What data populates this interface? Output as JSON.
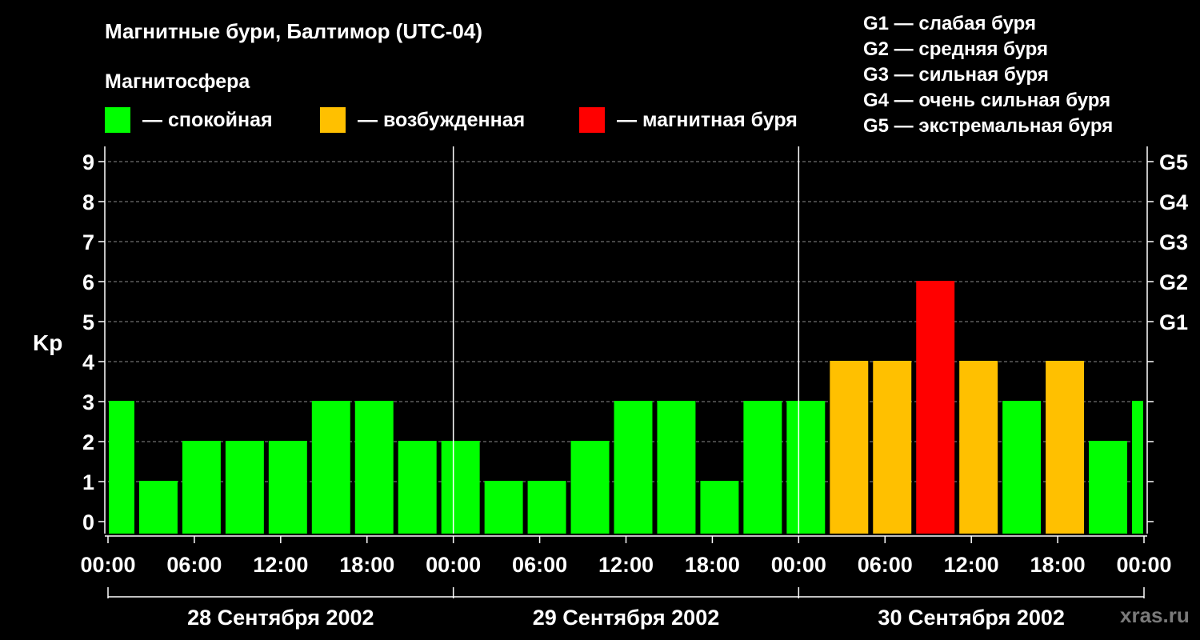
{
  "title": "Магнитные бури, Балтимор (UTC-04)",
  "legend": {
    "heading": "Магнитосфера",
    "items": [
      {
        "label": "— спокойная",
        "color": "#00ff00"
      },
      {
        "label": "— возбужденная",
        "color": "#ffc000"
      },
      {
        "label": "— магнитная буря",
        "color": "#ff0000"
      }
    ]
  },
  "g_scale": [
    "G1 — слабая буря",
    "G2 — средняя буря",
    "G3 — сильная буря",
    "G4 — очень сильная буря",
    "G5 — экстремальная буря"
  ],
  "watermark": "xras.ru",
  "chart_data": {
    "type": "bar",
    "ylabel": "Kp",
    "ylim": [
      0,
      9
    ],
    "yticks": [
      0,
      1,
      2,
      3,
      4,
      5,
      6,
      7,
      8,
      9
    ],
    "right_axis_labels": [
      {
        "kp": 5,
        "label": "G1"
      },
      {
        "kp": 6,
        "label": "G2"
      },
      {
        "kp": 7,
        "label": "G3"
      },
      {
        "kp": 8,
        "label": "G4"
      },
      {
        "kp": 9,
        "label": "G5"
      }
    ],
    "x_range_hours": [
      0,
      72
    ],
    "x_tick_hours": [
      0,
      6,
      12,
      18,
      24,
      30,
      36,
      42,
      48,
      54,
      60,
      66,
      72
    ],
    "x_tick_labels": [
      "00:00",
      "06:00",
      "12:00",
      "18:00",
      "00:00",
      "06:00",
      "12:00",
      "18:00",
      "00:00",
      "06:00",
      "12:00",
      "18:00",
      "00:00"
    ],
    "day_labels": [
      "28 Сентября 2002",
      "29 Сентября 2002",
      "30 Сентября 2002"
    ],
    "grid": "horizontal dashed",
    "bars": [
      {
        "start_hour": 0,
        "end_hour": 2,
        "kp": 3,
        "state": "quiet"
      },
      {
        "start_hour": 2,
        "end_hour": 5,
        "kp": 1,
        "state": "quiet"
      },
      {
        "start_hour": 5,
        "end_hour": 8,
        "kp": 2,
        "state": "quiet"
      },
      {
        "start_hour": 8,
        "end_hour": 11,
        "kp": 2,
        "state": "quiet"
      },
      {
        "start_hour": 11,
        "end_hour": 14,
        "kp": 2,
        "state": "quiet"
      },
      {
        "start_hour": 14,
        "end_hour": 17,
        "kp": 3,
        "state": "quiet"
      },
      {
        "start_hour": 17,
        "end_hour": 20,
        "kp": 3,
        "state": "quiet"
      },
      {
        "start_hour": 20,
        "end_hour": 23,
        "kp": 2,
        "state": "quiet"
      },
      {
        "start_hour": 23,
        "end_hour": 26,
        "kp": 2,
        "state": "quiet"
      },
      {
        "start_hour": 26,
        "end_hour": 29,
        "kp": 1,
        "state": "quiet"
      },
      {
        "start_hour": 29,
        "end_hour": 32,
        "kp": 1,
        "state": "quiet"
      },
      {
        "start_hour": 32,
        "end_hour": 35,
        "kp": 2,
        "state": "quiet"
      },
      {
        "start_hour": 35,
        "end_hour": 38,
        "kp": 3,
        "state": "quiet"
      },
      {
        "start_hour": 38,
        "end_hour": 41,
        "kp": 3,
        "state": "quiet"
      },
      {
        "start_hour": 41,
        "end_hour": 44,
        "kp": 1,
        "state": "quiet"
      },
      {
        "start_hour": 44,
        "end_hour": 47,
        "kp": 3,
        "state": "quiet"
      },
      {
        "start_hour": 47,
        "end_hour": 50,
        "kp": 3,
        "state": "quiet"
      },
      {
        "start_hour": 50,
        "end_hour": 53,
        "kp": 4,
        "state": "disturbed"
      },
      {
        "start_hour": 53,
        "end_hour": 56,
        "kp": 4,
        "state": "disturbed"
      },
      {
        "start_hour": 56,
        "end_hour": 59,
        "kp": 6,
        "state": "storm"
      },
      {
        "start_hour": 59,
        "end_hour": 62,
        "kp": 4,
        "state": "disturbed"
      },
      {
        "start_hour": 62,
        "end_hour": 65,
        "kp": 3,
        "state": "quiet"
      },
      {
        "start_hour": 65,
        "end_hour": 68,
        "kp": 4,
        "state": "disturbed"
      },
      {
        "start_hour": 68,
        "end_hour": 71,
        "kp": 2,
        "state": "quiet"
      },
      {
        "start_hour": 71,
        "end_hour": 72,
        "kp": 3,
        "state": "quiet"
      }
    ],
    "state_colors": {
      "quiet": "#00ff00",
      "disturbed": "#ffc000",
      "storm": "#ff0000"
    }
  }
}
